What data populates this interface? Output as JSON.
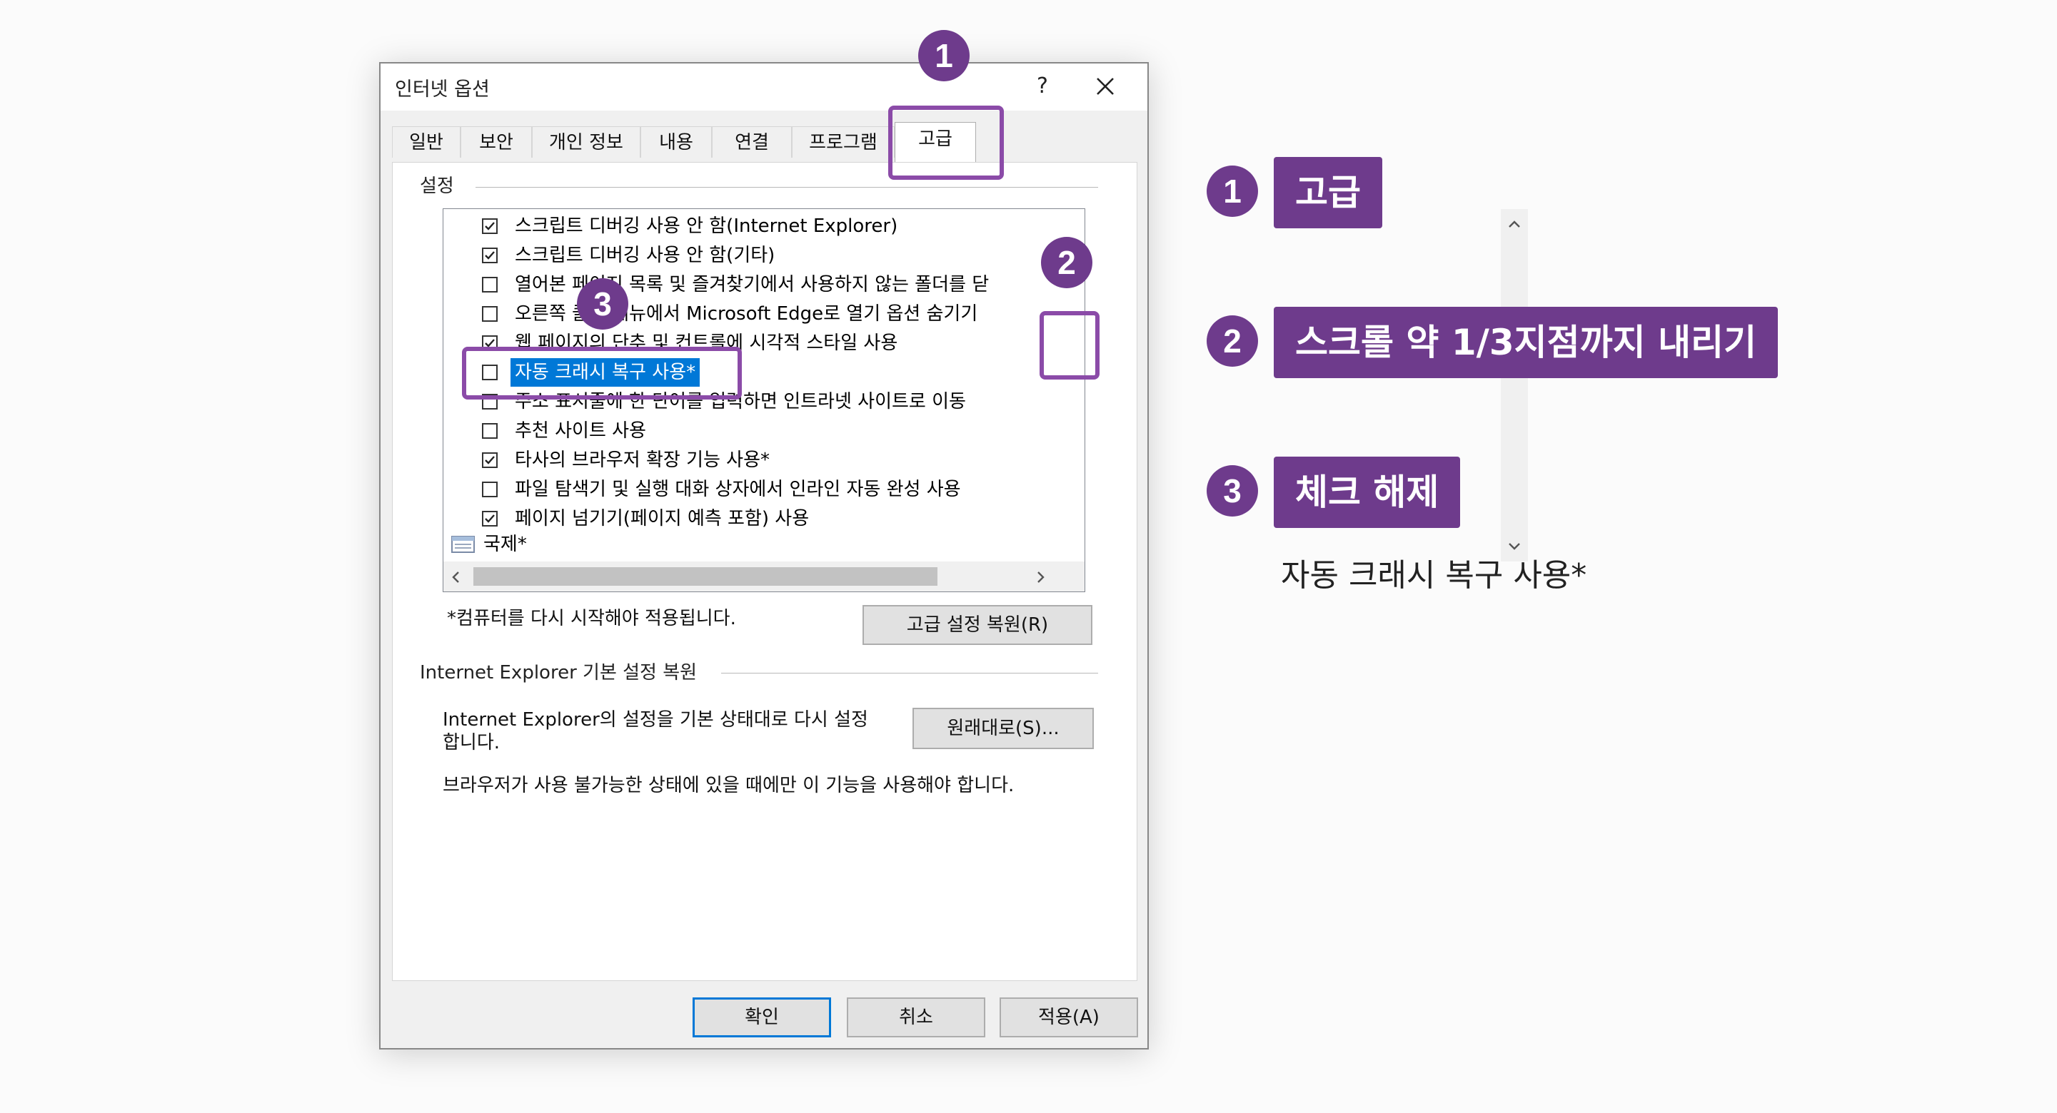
{
  "dialog": {
    "title": "인터넷 옵션",
    "help_label": "?",
    "tabs": [
      {
        "label": "일반"
      },
      {
        "label": "보안"
      },
      {
        "label": "개인 정보"
      },
      {
        "label": "내용"
      },
      {
        "label": "연결"
      },
      {
        "label": "프로그램"
      },
      {
        "label": "고급"
      }
    ],
    "active_tab": "고급",
    "settings_group_label": "설정",
    "settings_items": [
      {
        "label": "스크립트 디버깅 사용 안 함(Internet Explorer)",
        "checked": true
      },
      {
        "label": "스크립트 디버깅 사용 안 함(기타)",
        "checked": true
      },
      {
        "label": "열어본 페이지 목록 및 즐겨찾기에서 사용하지 않는 폴더를 닫",
        "checked": false
      },
      {
        "label": "오른쪽 클릭 메뉴에서 Microsoft Edge로 열기 옵션 숨기기",
        "checked": false
      },
      {
        "label": "웹 페이지의 단추 및 컨트롤에 시각적 스타일 사용",
        "checked": true
      },
      {
        "label": "자동 크래시 복구 사용*",
        "checked": false,
        "selected": true
      },
      {
        "label": "주소 표시줄에 한 단어를 입력하면 인트라넷 사이트로 이동",
        "checked": false
      },
      {
        "label": "추천 사이트 사용",
        "checked": false
      },
      {
        "label": "타사의 브라우저 확장 기능 사용*",
        "checked": true
      },
      {
        "label": "파일 탐색기 및 실행 대화 상자에서 인라인 자동 완성 사용",
        "checked": false
      },
      {
        "label": "페이지 넘기기(페이지 예측 포함) 사용",
        "checked": true
      }
    ],
    "category_item": "국제*",
    "restart_note": "*컴퓨터를 다시 시작해야 적용됩니다.",
    "restore_advanced_button": "고급 설정 복원(R)",
    "reset_group_label": "Internet Explorer 기본 설정 복원",
    "reset_description_line1": "Internet Explorer의 설정을 기본 상태대로 다시 설정",
    "reset_description_line2": "합니다.",
    "reset_button": "원래대로(S)...",
    "reset_warning": "브라우저가 사용 불가능한 상태에 있을 때에만 이 기능을 사용해야 합니다.",
    "ok_button": "확인",
    "cancel_button": "취소",
    "apply_button": "적용(A)"
  },
  "annotations": [
    {
      "number": "1",
      "label": "고급"
    },
    {
      "number": "2",
      "label": "스크롤 약 1/3지점까지 내리기"
    },
    {
      "number": "3",
      "label": "체크 해제",
      "note": "자동 크래시 복구 사용*"
    }
  ],
  "colors": {
    "accent_purple": "#6e3b8c",
    "highlight_border": "#8b4ba8",
    "selection_blue": "#0078d7"
  },
  "vertical_scroll_position": 0.33
}
